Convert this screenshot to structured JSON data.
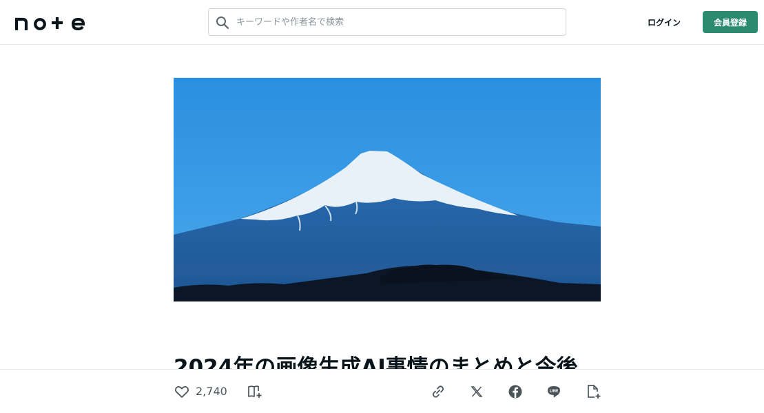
{
  "header": {
    "logo_text": "note",
    "search": {
      "placeholder": "キーワードや作者名で検索",
      "icon": "search-icon"
    },
    "login_label": "ログイン",
    "signup_label": "会員登録",
    "colors": {
      "signup_bg": "#2b8b6e"
    }
  },
  "article": {
    "hero_image": "mount-fuji-blue-sky",
    "title": "2024年の画像生成AI事情のまとめと今後"
  },
  "actions": {
    "like_icon": "heart-icon",
    "like_count": "2,740",
    "magazine_icon": "add-to-magazine-icon",
    "share_icons": [
      "link-icon",
      "x-icon",
      "facebook-icon",
      "line-icon",
      "save-note-icon"
    ]
  }
}
